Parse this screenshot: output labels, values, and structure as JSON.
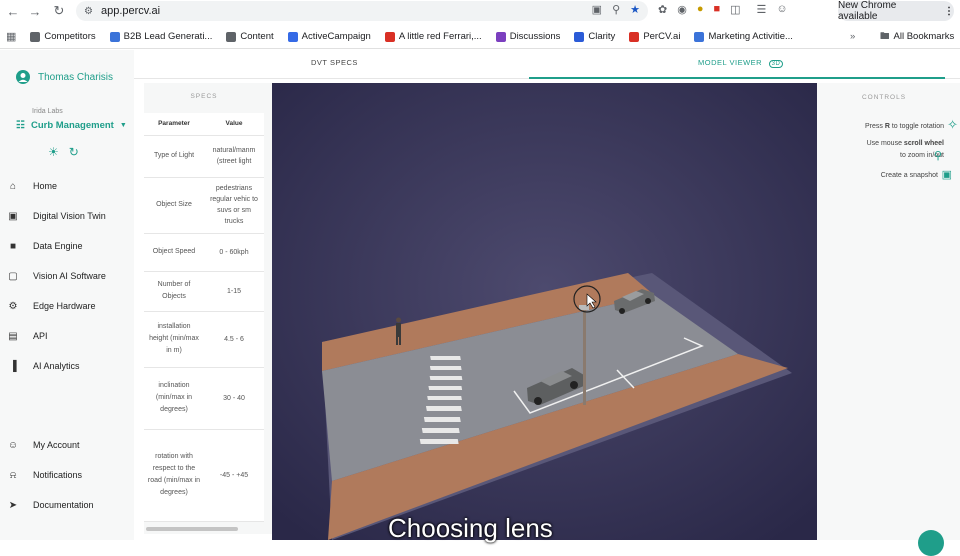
{
  "browser": {
    "url": "app.percv.ai",
    "new_chrome": "New Chrome available",
    "bookmarks": [
      {
        "label": "Competitors",
        "color": "#5f6368"
      },
      {
        "label": "B2B Lead Generati...",
        "color": "#3b73d9"
      },
      {
        "label": "Content",
        "color": "#5f6368"
      },
      {
        "label": "ActiveCampaign",
        "color": "#356ae6"
      },
      {
        "label": "A little red Ferrari,...",
        "color": "#d93025"
      },
      {
        "label": "Discussions",
        "color": "#7b3fbf"
      },
      {
        "label": "Clarity",
        "color": "#2b5bd7"
      },
      {
        "label": "PerCV.ai",
        "color": "#d93025"
      },
      {
        "label": "Marketing Activitie...",
        "color": "#3b73d9"
      }
    ],
    "all_bookmarks": "All Bookmarks"
  },
  "sidebar": {
    "user_name": "Thomas Charisis",
    "org": "Irida Labs",
    "project": "Curb Management",
    "nav": [
      {
        "label": "Home",
        "icon": "home-icon"
      },
      {
        "label": "Digital Vision Twin",
        "icon": "twin-icon"
      },
      {
        "label": "Data Engine",
        "icon": "camera-icon"
      },
      {
        "label": "Vision AI Software",
        "icon": "software-icon"
      },
      {
        "label": "Edge Hardware",
        "icon": "hardware-icon"
      },
      {
        "label": "API",
        "icon": "api-icon"
      },
      {
        "label": "AI Analytics",
        "icon": "analytics-icon"
      }
    ],
    "bottom_nav": [
      {
        "label": "My Account",
        "icon": "account-icon"
      },
      {
        "label": "Notifications",
        "icon": "bell-icon"
      },
      {
        "label": "Documentation",
        "icon": "rocket-icon"
      }
    ]
  },
  "tabs": {
    "dvt_specs": "DVT SPECS",
    "model_viewer": "MODEL VIEWER",
    "model_viewer_badge": "3D"
  },
  "specs": {
    "title": "SPECS",
    "header_param": "Parameter",
    "header_value": "Value",
    "rows": [
      {
        "param": "Type of Light",
        "value": "natural/manm (street light"
      },
      {
        "param": "Object Size",
        "value": "pedestrians regular vehic to suvs or sm trucks"
      },
      {
        "param": "Object Speed",
        "value": "0 - 60kph"
      },
      {
        "param": "Number of Objects",
        "value": "1-15"
      },
      {
        "param": "installation height (min/max in m)",
        "value": "4.5 - 6"
      },
      {
        "param": "inclination (min/max in degrees)",
        "value": "30 - 40"
      },
      {
        "param": "rotation with respect to the road (min/max in degrees)",
        "value": "-45 - +45"
      }
    ]
  },
  "controls": {
    "title": "CONTROLS",
    "rotate_a": "Press",
    "rotate_key": "R",
    "rotate_b": "to toggle rotation",
    "zoom_a": "Use mouse",
    "zoom_key": "scroll wheel",
    "zoom_b": "to zoom in/out",
    "snapshot": "Create a snapshot"
  },
  "subtitle": "Choosing lens"
}
